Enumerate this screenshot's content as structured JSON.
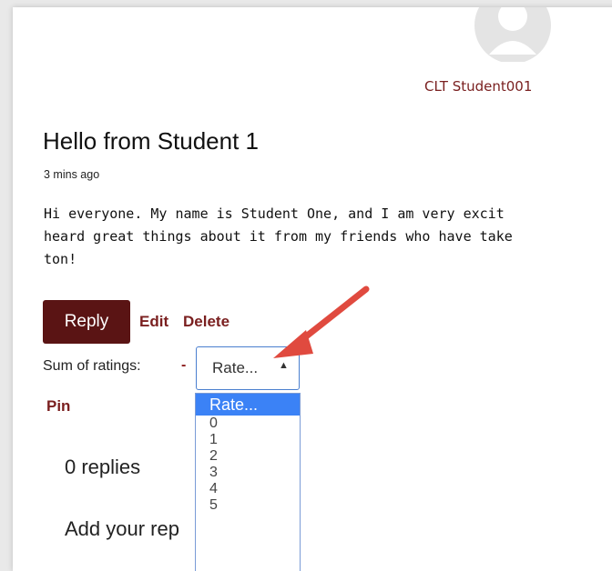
{
  "author": {
    "name": "CLT Student001"
  },
  "post": {
    "title": "Hello from Student 1",
    "time": "3 mins ago",
    "body_lines": [
      "Hi everyone. My name is Student One, and I am very excit",
      "heard great things about it from my friends who have take",
      "ton!"
    ]
  },
  "actions": {
    "reply": "Reply",
    "edit": "Edit",
    "delete": "Delete",
    "pin": "Pin"
  },
  "ratings": {
    "label": "Sum of ratings:",
    "sum": "-",
    "selected": "Rate...",
    "options": [
      "Rate...",
      "0",
      "1",
      "2",
      "3",
      "4",
      "5"
    ]
  },
  "replies": {
    "count_label": "0 replies",
    "add_label": "Add your rep"
  },
  "colors": {
    "accent": "#5a1414",
    "link": "#7a1f1f",
    "highlight": "#3b82f6",
    "arrow": "#e04a3f"
  }
}
